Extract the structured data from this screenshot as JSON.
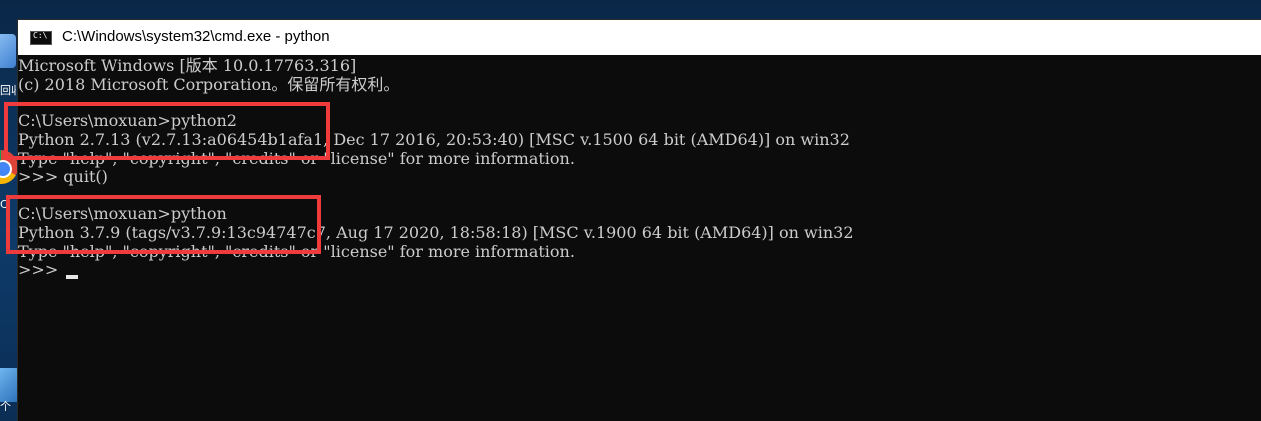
{
  "window": {
    "title": "C:\\Windows\\system32\\cmd.exe - python"
  },
  "desktop": {
    "icon_labels": [
      "回收",
      "C",
      "个"
    ]
  },
  "console": {
    "lines": [
      "Microsoft Windows [版本 10.0.17763.316]",
      "(c) 2018 Microsoft Corporation。保留所有权利。",
      "",
      "C:\\Users\\moxuan>python2",
      "Python 2.7.13 (v2.7.13:a06454b1afa1, Dec 17 2016, 20:53:40) [MSC v.1500 64 bit (AMD64)] on win32",
      "Type \"help\", \"copyright\", \"credits\" or \"license\" for more information.",
      ">>> quit()",
      "",
      "C:\\Users\\moxuan>python",
      "Python 3.7.9 (tags/v3.7.9:13c94747c7, Aug 17 2020, 18:58:18) [MSC v.1900 64 bit (AMD64)] on win32",
      "Type \"help\", \"copyright\", \"credits\" or \"license\" for more information.",
      ">>> "
    ]
  },
  "colors": {
    "highlight": "#ef3b3b",
    "console_bg": "#0c0c0c",
    "console_fg": "#cccccc"
  }
}
